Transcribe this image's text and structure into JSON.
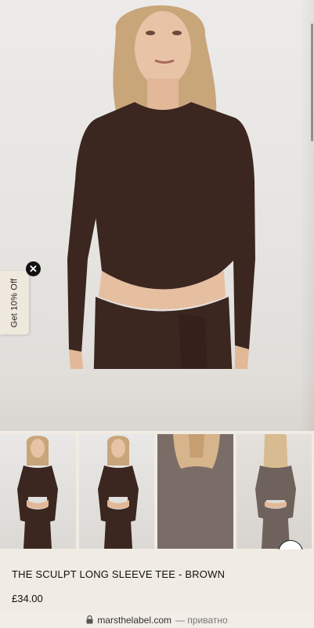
{
  "promo": {
    "label": "Get 10% Off",
    "close_glyph": "✕"
  },
  "product": {
    "title": "THE SCULPT LONG SLEEVE TEE - BROWN",
    "price": "£34.00"
  },
  "browser": {
    "domain": "marsthelabel.com",
    "suffix": "— приватно",
    "lock_icon": "lock-icon"
  },
  "colors": {
    "garment_brown": "#3b2620",
    "page_bg": "#f0ebe3",
    "thumb3_bg": "#7a6d67"
  },
  "thumbnails": [
    {
      "name": "front-view"
    },
    {
      "name": "front-view-hand"
    },
    {
      "name": "back-detail"
    },
    {
      "name": "back-view"
    }
  ]
}
